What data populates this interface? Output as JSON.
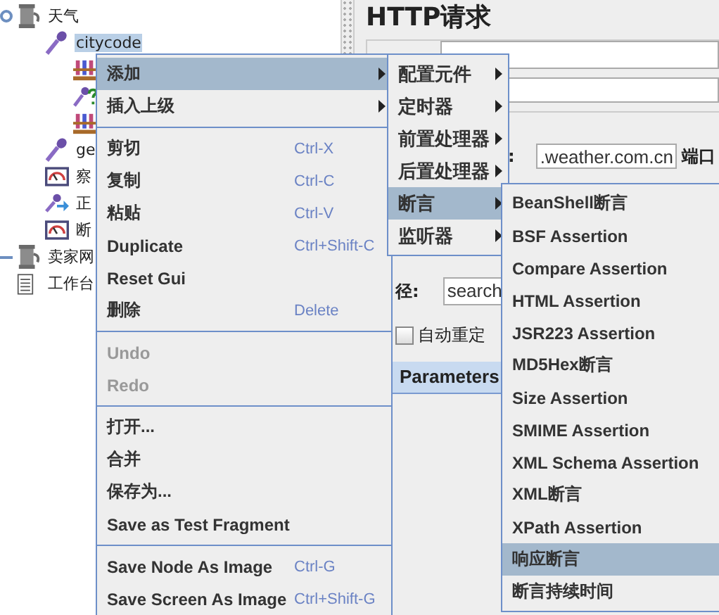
{
  "tree": {
    "items": [
      {
        "label": "天气",
        "kind": "plan",
        "expanded": true,
        "selected": false,
        "children": [
          {
            "label": "citycode",
            "kind": "sampler",
            "selected": true,
            "children": [
              {
                "kind": "config"
              },
              {
                "kind": "question"
              },
              {
                "kind": "config"
              }
            ]
          },
          {
            "label": "ge",
            "kind": "sampler",
            "selected": false
          },
          {
            "label": "察",
            "kind": "listener",
            "selected": false
          },
          {
            "label": "正",
            "kind": "redirect",
            "selected": false
          },
          {
            "label": "断",
            "kind": "listener",
            "selected": false
          }
        ]
      },
      {
        "label": "卖家网",
        "kind": "plan",
        "expanded": false,
        "selected": false
      },
      {
        "label": "工作台",
        "kind": "workbench",
        "selected": false
      }
    ]
  },
  "editor": {
    "title": "HTTP请求",
    "server_label": ":",
    "server_value": ".weather.com.cn",
    "port_label": "端口",
    "path_label": "径:",
    "path_value": "search",
    "redirect_label": "自动重定",
    "redirect_checked": false,
    "tab": "Parameters"
  },
  "context_menu": {
    "sections": [
      [
        {
          "label": "添加",
          "submenu": true,
          "selected": true
        },
        {
          "label": "插入上级",
          "submenu": true,
          "selected": false
        }
      ],
      [
        {
          "label": "剪切",
          "shortcut": "Ctrl-X",
          "selected": false
        },
        {
          "label": "复制",
          "shortcut": "Ctrl-C",
          "selected": false
        },
        {
          "label": "粘贴",
          "shortcut": "Ctrl-V",
          "selected": false
        },
        {
          "label": "Duplicate",
          "shortcut": "Ctrl+Shift-C",
          "selected": false
        },
        {
          "label": "Reset Gui",
          "selected": false
        },
        {
          "label": "删除",
          "shortcut": "Delete",
          "selected": false
        }
      ],
      [
        {
          "label": "Undo",
          "disabled": true,
          "selected": false
        },
        {
          "label": "Redo",
          "disabled": true,
          "selected": false
        }
      ],
      [
        {
          "label": "打开...",
          "selected": false
        },
        {
          "label": "合并",
          "selected": false
        },
        {
          "label": "保存为...",
          "selected": false
        },
        {
          "label": "Save as Test Fragment",
          "selected": false
        }
      ],
      [
        {
          "label": "Save Node As Image",
          "shortcut": "Ctrl-G",
          "selected": false
        },
        {
          "label": "Save Screen As Image",
          "shortcut": "Ctrl+Shift-G",
          "selected": false
        }
      ]
    ]
  },
  "add_submenu": {
    "items": [
      {
        "label": "配置元件",
        "submenu": true,
        "selected": false
      },
      {
        "label": "定时器",
        "submenu": true,
        "selected": false
      },
      {
        "label": "前置处理器",
        "submenu": true,
        "selected": false
      },
      {
        "label": "后置处理器",
        "submenu": true,
        "selected": false
      },
      {
        "label": "断言",
        "submenu": true,
        "selected": true
      },
      {
        "label": "监听器",
        "submenu": true,
        "selected": false
      }
    ]
  },
  "assertion_submenu": {
    "items": [
      {
        "label": "BeanShell断言",
        "selected": false
      },
      {
        "label": "BSF Assertion",
        "selected": false
      },
      {
        "label": "Compare Assertion",
        "selected": false
      },
      {
        "label": "HTML Assertion",
        "selected": false
      },
      {
        "label": "JSR223 Assertion",
        "selected": false
      },
      {
        "label": "MD5Hex断言",
        "selected": false
      },
      {
        "label": "Size Assertion",
        "selected": false
      },
      {
        "label": "SMIME Assertion",
        "selected": false
      },
      {
        "label": "XML Schema Assertion",
        "selected": false
      },
      {
        "label": "XML断言",
        "selected": false
      },
      {
        "label": "XPath Assertion",
        "selected": false
      },
      {
        "label": "响应断言",
        "selected": true
      },
      {
        "label": "断言持续时间",
        "selected": false
      }
    ]
  }
}
